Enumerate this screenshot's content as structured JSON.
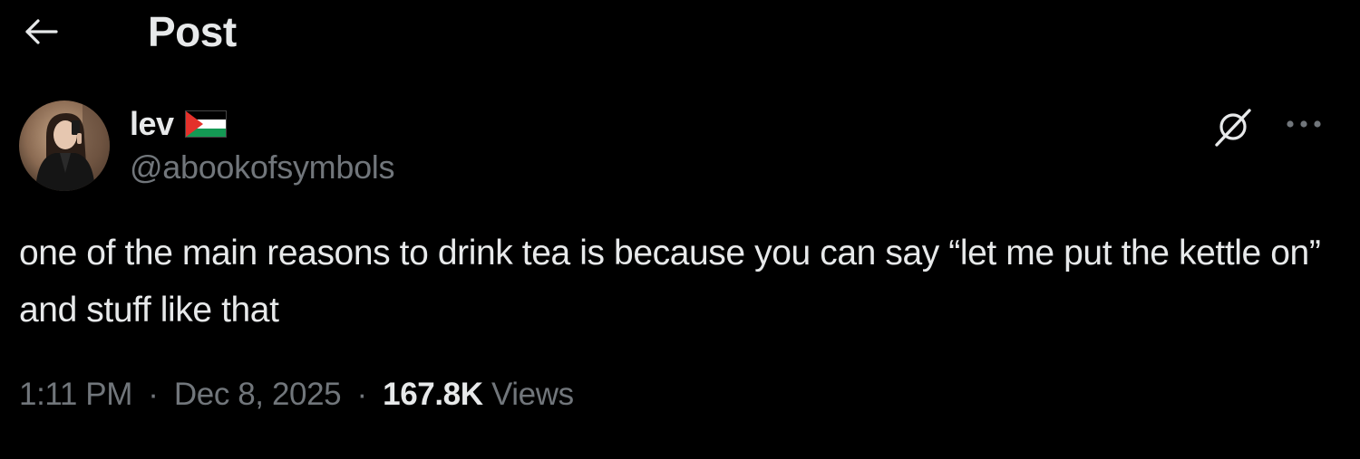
{
  "header": {
    "title": "Post",
    "back_icon": "arrow-left-icon"
  },
  "author": {
    "display_name": "lev",
    "handle": "@abookofsymbols",
    "flag_icon": "palestine-flag-icon",
    "avatar_icon": "avatar-photo"
  },
  "actions": {
    "grok_icon": "grok-icon",
    "more_icon": "more-horizontal-icon"
  },
  "post": {
    "text": "one of the main reasons to drink tea is because you can say “let me put the kettle on” and stuff like that"
  },
  "meta": {
    "time": "1:11 PM",
    "separator": "·",
    "date": "Dec 8, 2025",
    "views_count": "167.8K",
    "views_label": "Views"
  },
  "colors": {
    "background": "#000000",
    "primary_text": "#e7e9ea",
    "secondary_text": "#71767b"
  }
}
